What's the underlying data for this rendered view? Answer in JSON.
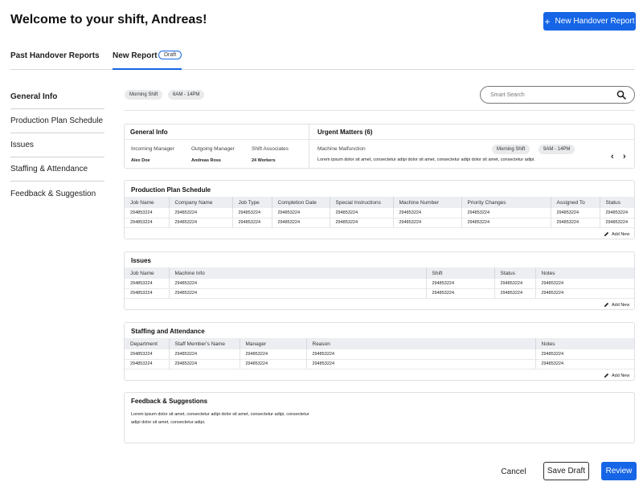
{
  "header": {
    "title": "Welcome to your shift, Andreas!",
    "new_report_label": "New Handover Report",
    "new_report_icon": "plus-icon"
  },
  "tabs": {
    "past": "Past Handover Reports",
    "new": "New Report",
    "draft_badge": "Draft"
  },
  "sidebar": {
    "items": [
      {
        "label": "General Info"
      },
      {
        "label": "Production Plan Schedule"
      },
      {
        "label": "Issues"
      },
      {
        "label": "Staffing & Attendance"
      },
      {
        "label": "Feedback & Suggestion"
      }
    ]
  },
  "filters": {
    "shift": "Morning Shift",
    "time": "6AM - 14PM",
    "search_placeholder": "Smart Search"
  },
  "general_info": {
    "title": "General Info",
    "incoming_label": "Incoming Manager",
    "incoming_value": "Alex Doe",
    "outgoing_label": "Outgoing Manager",
    "outgoing_value": "Andreas Ross",
    "associates_label": "Shift Associates",
    "associates_value": "24 Workers"
  },
  "urgent": {
    "title": "Urgent Matters (6)",
    "item_title": "Machine Malfunction",
    "shift": "Morning Shift",
    "time": "9AM - 14PM",
    "text": "Lorem ipsum dolor sit amet, consectetur adipi dolor sit amet, consectetur adipi dolor sit amet, consectetur adipi."
  },
  "production": {
    "title": "Production Plan Schedule",
    "columns": [
      "Job Name",
      "Company Name",
      "Job Type",
      "Completion Date",
      "Special Instructions",
      "Machine Number",
      "Priority Changes",
      "Assigned To",
      "Status"
    ],
    "rows": [
      [
        "294853224",
        "294853224",
        "294853224",
        "294853224",
        "294853224",
        "294853224",
        "294853224",
        "294853224",
        "294853224"
      ],
      [
        "294853224",
        "294853224",
        "294853224",
        "294853224",
        "294853224",
        "294853224",
        "294853224",
        "294853224",
        "294853224"
      ]
    ],
    "add_new": "Add New"
  },
  "issues": {
    "title": "Issues",
    "columns": [
      "Job Name",
      "Machine Info",
      "Shift",
      "Status",
      "Notes"
    ],
    "rows": [
      [
        "294853224",
        "294853224",
        "294853224",
        "294853224",
        "294853224"
      ],
      [
        "294853224",
        "294853224",
        "294853224",
        "294853224",
        "294853224"
      ]
    ],
    "add_new": "Add New"
  },
  "staffing": {
    "title": "Staffing and Attendance",
    "columns": [
      "Department",
      "Staff Member's Name",
      "Manager",
      "Reason",
      "Notes"
    ],
    "rows": [
      [
        "294853224",
        "294853224",
        "294853224",
        "294853224",
        "294853224"
      ],
      [
        "294853224",
        "294853224",
        "294853224",
        "294853224",
        "294853224"
      ]
    ],
    "add_new": "Add New"
  },
  "feedback": {
    "title": "Feedback & Suggestions",
    "text": "Lorem ipsum dolor sit amet, consectetur adipi dolor sit amet, consectetur adipi, consectetur adipi dolor sit amet, consectetur adipi."
  },
  "footer": {
    "cancel": "Cancel",
    "save_draft": "Save Draft",
    "review": "Review"
  },
  "colors": {
    "accent": "#1565e6"
  }
}
